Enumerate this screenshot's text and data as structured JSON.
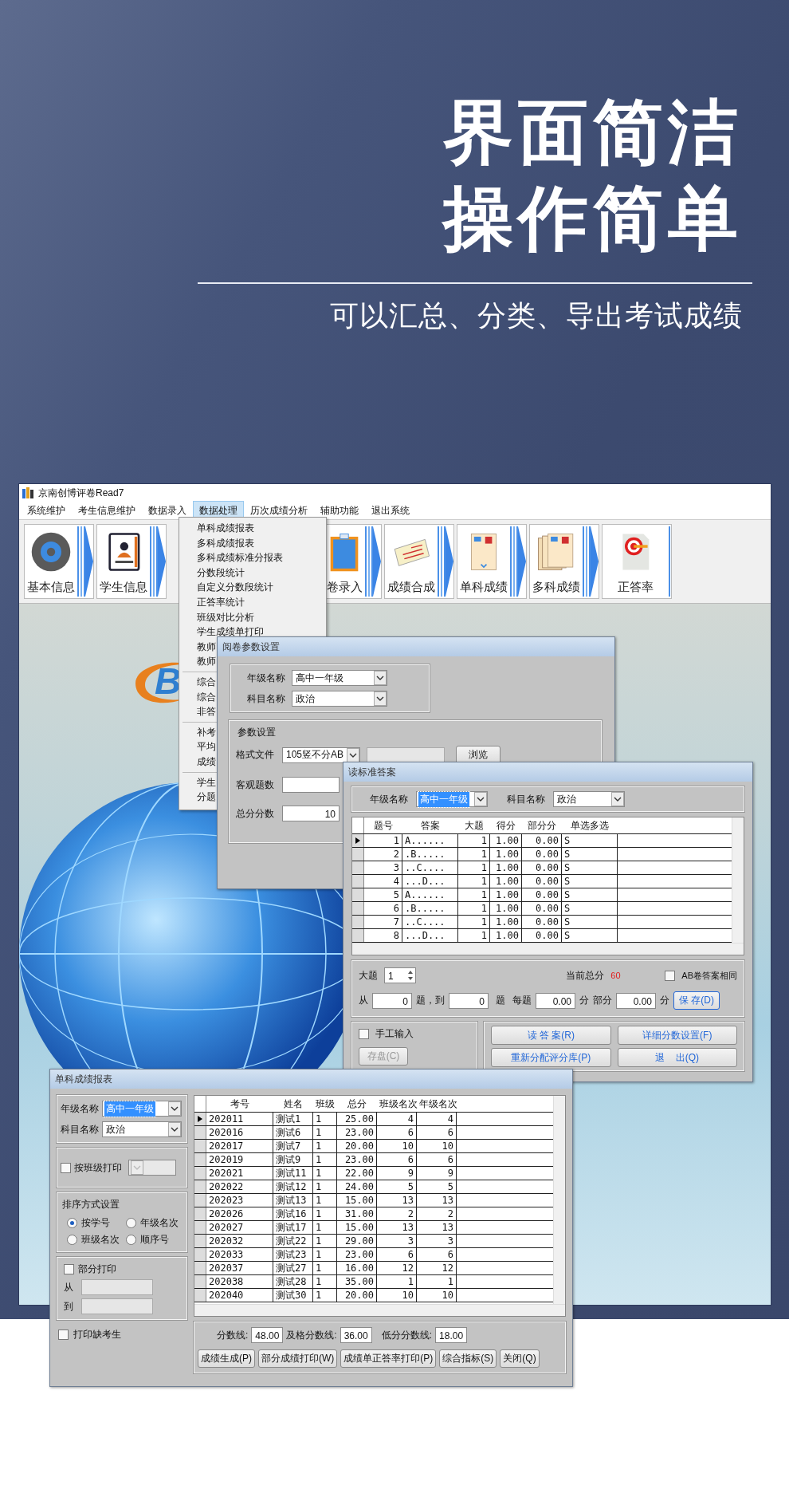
{
  "headline": [
    "界面简洁",
    "操作简单"
  ],
  "subtitle": "可以汇总、分类、导出考试成绩",
  "app": {
    "title": "京南创博评卷Read7",
    "menu": [
      {
        "label": "系统维护",
        "selected": false
      },
      {
        "label": "考生信息维护",
        "selected": false
      },
      {
        "label": "数据录入",
        "selected": false
      },
      {
        "label": "数据处理",
        "selected": true
      },
      {
        "label": "历次成绩分析",
        "selected": false
      },
      {
        "label": "辅助功能",
        "selected": false
      },
      {
        "label": "退出系统",
        "selected": false
      }
    ],
    "toolbar": [
      {
        "label": "基本信息",
        "kind": "gear",
        "arrow": true
      },
      {
        "label": "学生信息",
        "kind": "contacts",
        "arrow": true
      },
      {
        "label": "卷录入",
        "kind": "clipboard",
        "arrow": true
      },
      {
        "label": "成绩合成",
        "kind": "certificate",
        "arrow": true
      },
      {
        "label": "单科成绩",
        "kind": "sheet",
        "arrow": true
      },
      {
        "label": "多科成绩",
        "kind": "sheets",
        "arrow": true
      },
      {
        "label": "正答率",
        "kind": "target",
        "arrow": false
      }
    ],
    "logo_text": "B",
    "dropdown": [
      [
        "单科成绩报表",
        "多科成绩报表",
        "多科成绩标准分报表",
        "分数段统计",
        "自定义分数段统计",
        "正答率统计",
        "班级对比分析",
        "学生成绩单打印",
        "教师",
        "教师"
      ],
      [
        "综合",
        "综合",
        "非答"
      ],
      [
        "补考",
        "平均",
        "成绩"
      ],
      [
        "学生",
        "分题"
      ]
    ]
  },
  "params_dialog": {
    "title": "阅卷参数设置",
    "grade_label": "年级名称",
    "grade": "高中一年级",
    "subject_label": "科目名称",
    "subject": "政治",
    "group_title": "参数设置",
    "format_label": "格式文件",
    "format": "105竖不分AB",
    "browse": "浏览",
    "objective_label": "客观题数",
    "total_label": "总分分数",
    "total": "10"
  },
  "answer_dialog": {
    "title": "读标准答案",
    "grade_label": "年级名称",
    "grade": "高中一年级",
    "grade_selected": true,
    "subject_label": "科目名称",
    "subject": "政治",
    "columns": [
      "题号",
      "答案",
      "大题",
      "得分",
      "部分分",
      "单选多选"
    ],
    "rows": [
      {
        "current": true,
        "cells": [
          "1",
          "A......",
          "1",
          "1.00",
          "0.00",
          "S"
        ]
      },
      {
        "current": false,
        "cells": [
          "2",
          ".B.....",
          "1",
          "1.00",
          "0.00",
          "S"
        ]
      },
      {
        "current": false,
        "cells": [
          "3",
          "..C....",
          "1",
          "1.00",
          "0.00",
          "S"
        ]
      },
      {
        "current": false,
        "cells": [
          "4",
          "...D...",
          "1",
          "1.00",
          "0.00",
          "S"
        ]
      },
      {
        "current": false,
        "cells": [
          "5",
          "A......",
          "1",
          "1.00",
          "0.00",
          "S"
        ]
      },
      {
        "current": false,
        "cells": [
          "6",
          ".B.....",
          "1",
          "1.00",
          "0.00",
          "S"
        ]
      },
      {
        "current": false,
        "cells": [
          "7",
          "..C....",
          "1",
          "1.00",
          "0.00",
          "S"
        ]
      },
      {
        "current": false,
        "cells": [
          "8",
          "...D...",
          "1",
          "1.00",
          "0.00",
          "S"
        ]
      }
    ],
    "big_label": "大题",
    "big": "1",
    "current_total_label": "当前总分",
    "current_total": "60",
    "ab_label": "AB卷答案相同",
    "ab_checked": false,
    "from_label": "从",
    "from": "0",
    "to_label": "题，到",
    "to": "0",
    "unit1": "题",
    "each_label": "每题",
    "each": "0.00",
    "unit2": "分",
    "partial_label": "部分",
    "partial": "0.00",
    "unit3": "分",
    "save": "保 存(D)",
    "manual_label": "手工输入",
    "manual_checked": false,
    "store": {
      "label": "存盘(C)",
      "disabled": true
    },
    "buttons": [
      "读 答 案(R)",
      "详细分数设置(F)",
      "重新分配评分库(P)",
      "退    出(Q)"
    ]
  },
  "report_dialog": {
    "title": "单科成绩报表",
    "grade_label": "年级名称",
    "grade": "高中一年级",
    "grade_selected": true,
    "subject_label": "科目名称",
    "subject": "政治",
    "class_print_label": "按班级打印",
    "class_print_checked": false,
    "class_combo_disabled": true,
    "sort_title": "排序方式设置",
    "sort_options": [
      {
        "label": "按学号",
        "selected": true
      },
      {
        "label": "年级名次",
        "selected": false
      },
      {
        "label": "班级名次",
        "selected": false
      },
      {
        "label": "顺序号",
        "selected": false
      }
    ],
    "partial_print_label": "部分打印",
    "partial_print_checked": false,
    "from_label": "从",
    "to_label": "到",
    "absent_label": "打印缺考生",
    "absent_checked": false,
    "columns": [
      "考号",
      "姓名",
      "班级",
      "总分",
      "班级名次",
      "年级名次"
    ],
    "rows": [
      {
        "current": true,
        "cells": [
          "202011",
          "测试1",
          "1",
          "25.00",
          "4",
          "4"
        ]
      },
      {
        "current": false,
        "cells": [
          "202016",
          "测试6",
          "1",
          "23.00",
          "6",
          "6"
        ]
      },
      {
        "current": false,
        "cells": [
          "202017",
          "测试7",
          "1",
          "20.00",
          "10",
          "10"
        ]
      },
      {
        "current": false,
        "cells": [
          "202019",
          "测试9",
          "1",
          "23.00",
          "6",
          "6"
        ]
      },
      {
        "current": false,
        "cells": [
          "202021",
          "测试11",
          "1",
          "22.00",
          "9",
          "9"
        ]
      },
      {
        "current": false,
        "cells": [
          "202022",
          "测试12",
          "1",
          "24.00",
          "5",
          "5"
        ]
      },
      {
        "current": false,
        "cells": [
          "202023",
          "测试13",
          "1",
          "15.00",
          "13",
          "13"
        ]
      },
      {
        "current": false,
        "cells": [
          "202026",
          "测试16",
          "1",
          "31.00",
          "2",
          "2"
        ]
      },
      {
        "current": false,
        "cells": [
          "202027",
          "测试17",
          "1",
          "15.00",
          "13",
          "13"
        ]
      },
      {
        "current": false,
        "cells": [
          "202032",
          "测试22",
          "1",
          "29.00",
          "3",
          "3"
        ]
      },
      {
        "current": false,
        "cells": [
          "202033",
          "测试23",
          "1",
          "23.00",
          "6",
          "6"
        ]
      },
      {
        "current": false,
        "cells": [
          "202037",
          "测试27",
          "1",
          "16.00",
          "12",
          "12"
        ]
      },
      {
        "current": false,
        "cells": [
          "202038",
          "测试28",
          "1",
          "35.00",
          "1",
          "1"
        ]
      },
      {
        "current": false,
        "cells": [
          "202040",
          "测试30",
          "1",
          "20.00",
          "10",
          "10"
        ]
      }
    ],
    "line_label": "分数线:",
    "line": "48.00",
    "pass_label": "及格分数线:",
    "pass": "36.00",
    "low_label": "低分分数线:",
    "low": "18.00",
    "buttons": [
      "成绩生成(P)",
      "部分成绩打印(W)",
      "成绩单正答率打印(P)",
      "综合指标(S)",
      "关闭(Q)"
    ]
  }
}
